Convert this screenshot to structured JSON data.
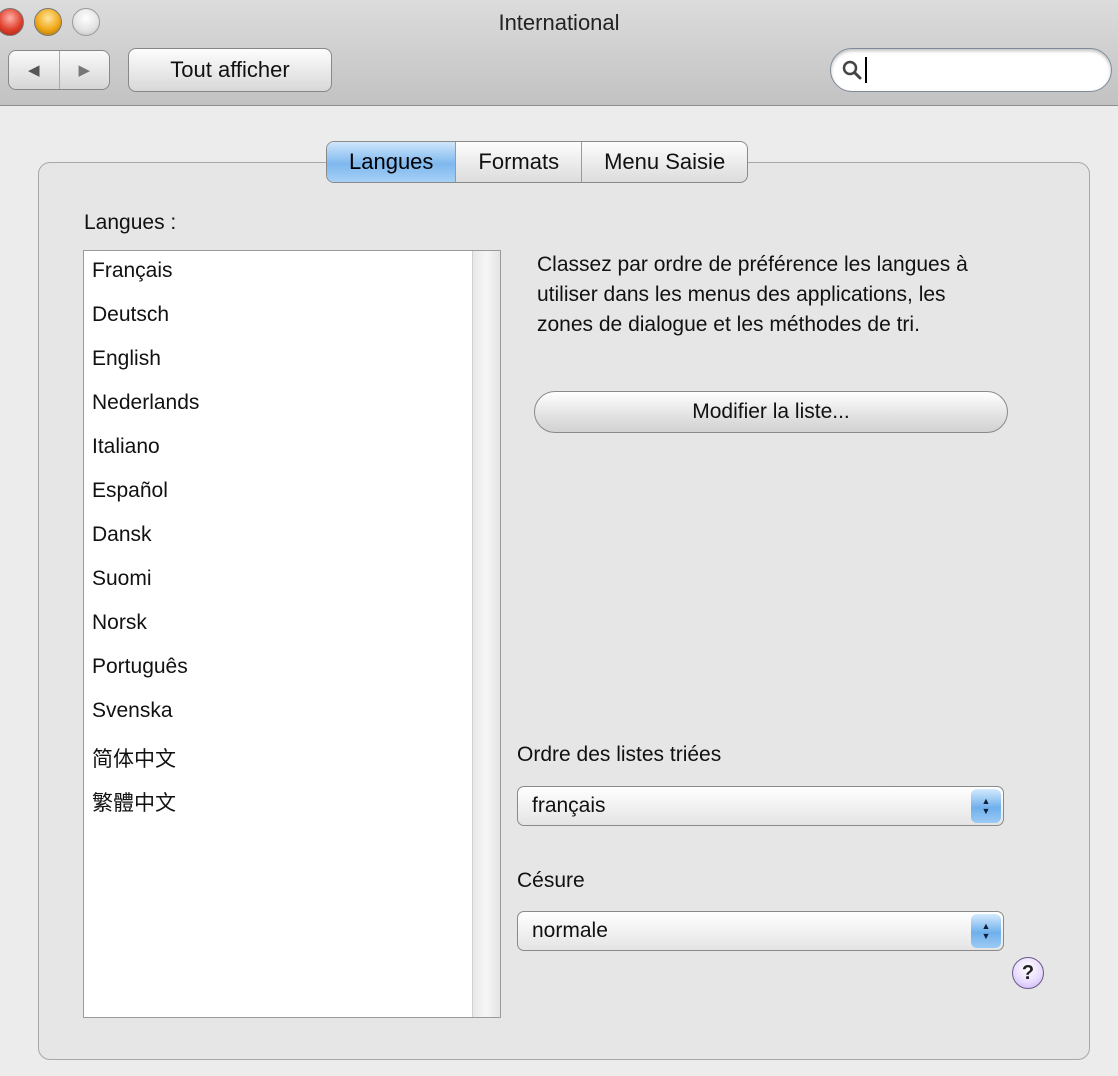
{
  "window": {
    "title": "International"
  },
  "toolbar": {
    "back_glyph": "◀",
    "forward_glyph": "▶",
    "show_all_label": "Tout afficher",
    "search_value": "",
    "search_placeholder": ""
  },
  "tabs": [
    {
      "label": "Langues",
      "active": true
    },
    {
      "label": "Formats",
      "active": false
    },
    {
      "label": "Menu Saisie",
      "active": false
    }
  ],
  "languages": {
    "label": "Langues :",
    "items": [
      "Français",
      "Deutsch",
      "English",
      "Nederlands",
      "Italiano",
      "Español",
      "Dansk",
      "Suomi",
      "Norsk",
      "Português",
      "Svenska",
      "简体中文",
      "繁體中文"
    ]
  },
  "description": "Classez par ordre de préférence les langues à utiliser dans les menus des applications, les zones de dialogue et les méthodes de tri.",
  "modify_button_label": "Modifier la liste...",
  "sort_order": {
    "label": "Ordre des listes triées",
    "value": "français"
  },
  "hyphenation": {
    "label": "Césure",
    "value": "normale"
  },
  "help_glyph": "?",
  "colors": {
    "accent": "#7fb8ee",
    "background": "#ececec"
  }
}
